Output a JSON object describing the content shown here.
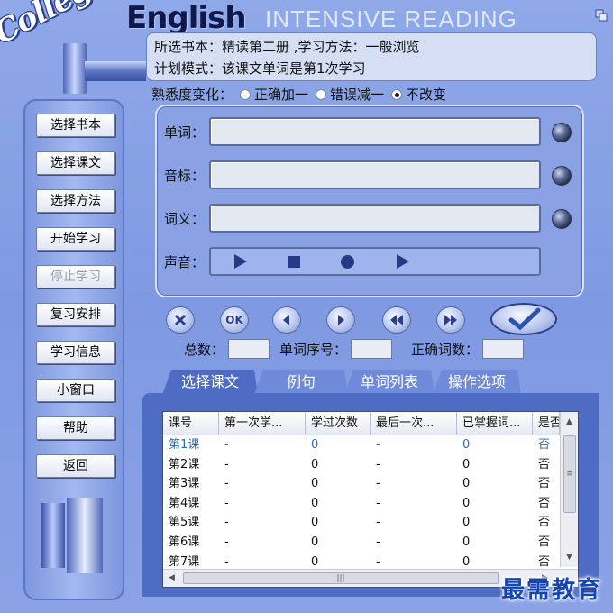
{
  "header": {
    "logo_college": "College",
    "logo_english": "English",
    "subtitle": "INTENSIVE  READING"
  },
  "info": {
    "line1": "所选书本：精读第二册 ,学习方法：一般浏览",
    "line2": "计划模式：该课文单词是第1次学习"
  },
  "familiarity": {
    "label": "熟悉度变化：",
    "options": [
      "正确加一",
      "错误减一",
      "不改变"
    ],
    "selected": 2
  },
  "sidebar": {
    "buttons": [
      {
        "label": "选择书本",
        "enabled": true
      },
      {
        "label": "选择课文",
        "enabled": true
      },
      {
        "label": "选择方法",
        "enabled": true
      },
      {
        "label": "开始学习",
        "enabled": true
      },
      {
        "label": "停止学习",
        "enabled": false
      },
      {
        "label": "复习安排",
        "enabled": true
      },
      {
        "label": "学习信息",
        "enabled": true
      },
      {
        "label": "小窗口",
        "enabled": true
      },
      {
        "label": "帮助",
        "enabled": true
      },
      {
        "label": "返回",
        "enabled": true
      }
    ]
  },
  "fields": {
    "word_label": "单词：",
    "phonetic_label": "音标：",
    "meaning_label": "词义：",
    "sound_label": "声音：",
    "word_value": "",
    "phonetic_value": "",
    "meaning_value": ""
  },
  "controls": {
    "ok_label": "OK"
  },
  "counts": {
    "total_label": "总数：",
    "index_label": "单词序号：",
    "correct_label": "正确词数：",
    "total_value": "",
    "index_value": "",
    "correct_value": ""
  },
  "tabs": [
    "选择课文",
    "例句",
    "单词列表",
    "操作选项"
  ],
  "table": {
    "columns": [
      "课号",
      "第一次学...",
      "学过次数",
      "最后一次...",
      "已掌握词...",
      "是否"
    ],
    "rows": [
      [
        "第1课",
        "-",
        "0",
        "-",
        "0",
        "否"
      ],
      [
        "第2课",
        "-",
        "0",
        "-",
        "0",
        "否"
      ],
      [
        "第3课",
        "-",
        "0",
        "-",
        "0",
        "否"
      ],
      [
        "第4课",
        "-",
        "0",
        "-",
        "0",
        "否"
      ],
      [
        "第5课",
        "-",
        "0",
        "-",
        "0",
        "否"
      ],
      [
        "第6课",
        "-",
        "0",
        "-",
        "0",
        "否"
      ],
      [
        "第7课",
        "-",
        "0",
        "-",
        "0",
        "否"
      ]
    ]
  },
  "watermark": "最需教育",
  "colors": {
    "background": "#8fa8e8",
    "tab_active": "#4f6cc4",
    "accent": "#243a86"
  }
}
